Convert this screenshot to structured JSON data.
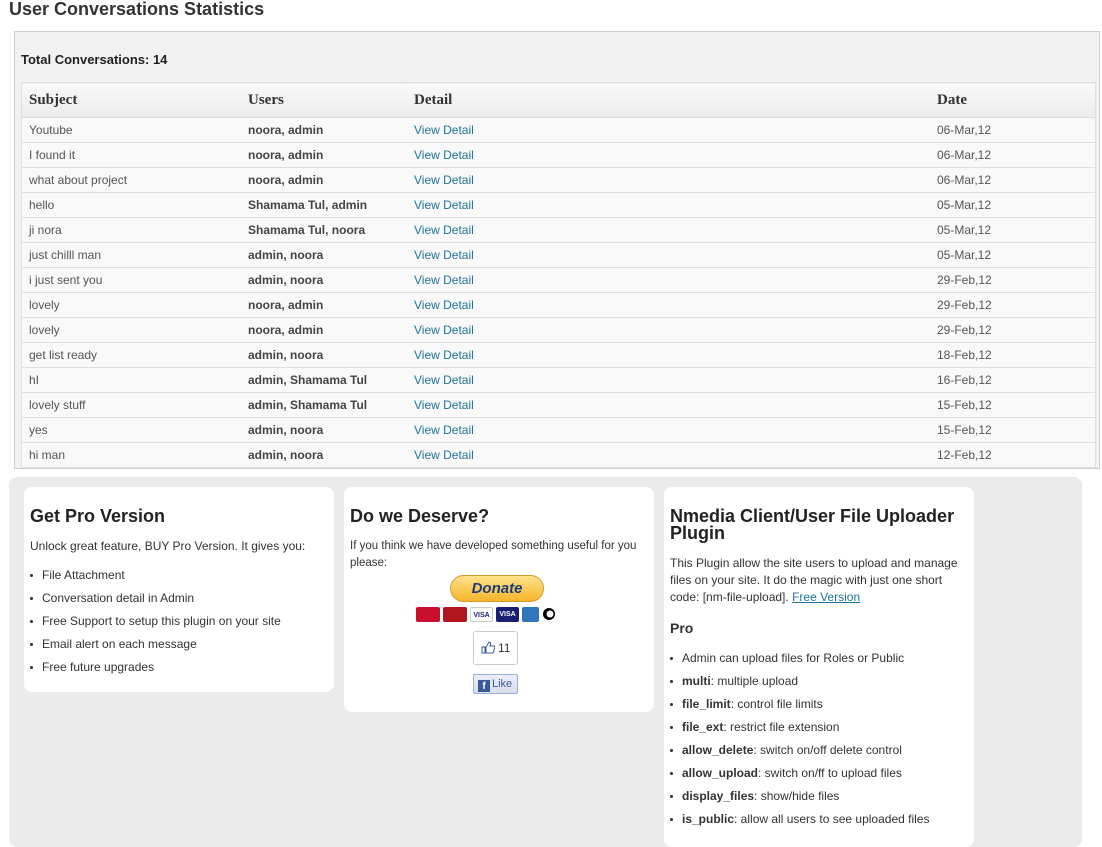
{
  "page_title": "User Conversations Statistics",
  "total_label": "Total Conversations: 14",
  "table": {
    "headers": [
      "Subject",
      "Users",
      "Detail",
      "Date"
    ],
    "rows": [
      {
        "subject": "Youtube",
        "users": "noora, admin",
        "detail": "View Detail",
        "date": "06-Mar,12"
      },
      {
        "subject": "I found it",
        "users": "noora, admin",
        "detail": "View Detail",
        "date": "06-Mar,12"
      },
      {
        "subject": "what about project",
        "users": "noora, admin",
        "detail": "View Detail",
        "date": "06-Mar,12"
      },
      {
        "subject": "hello",
        "users": "Shamama Tul, admin",
        "detail": "View Detail",
        "date": "05-Mar,12"
      },
      {
        "subject": "ji nora",
        "users": "Shamama Tul, noora",
        "detail": "View Detail",
        "date": "05-Mar,12"
      },
      {
        "subject": "just chilll man",
        "users": "admin, noora",
        "detail": "View Detail",
        "date": "05-Mar,12"
      },
      {
        "subject": "i just sent you",
        "users": "admin, noora",
        "detail": "View Detail",
        "date": "29-Feb,12"
      },
      {
        "subject": "lovely",
        "users": "noora, admin",
        "detail": "View Detail",
        "date": "29-Feb,12"
      },
      {
        "subject": "lovely",
        "users": "noora, admin",
        "detail": "View Detail",
        "date": "29-Feb,12"
      },
      {
        "subject": "get list ready",
        "users": "admin, noora",
        "detail": "View Detail",
        "date": "18-Feb,12"
      },
      {
        "subject": "hI",
        "users": "admin, Shamama Tul",
        "detail": "View Detail",
        "date": "16-Feb,12"
      },
      {
        "subject": "lovely stuff",
        "users": "admin, Shamama Tul",
        "detail": "View Detail",
        "date": "15-Feb,12"
      },
      {
        "subject": "yes",
        "users": "admin, noora",
        "detail": "View Detail",
        "date": "15-Feb,12"
      },
      {
        "subject": "hi man",
        "users": "admin, noora",
        "detail": "View Detail",
        "date": "12-Feb,12"
      }
    ]
  },
  "pro_card": {
    "title": "Get Pro Version",
    "intro": "Unlock great feature, BUY Pro Version. It gives you:",
    "features": [
      "File Attachment",
      "Conversation detail in Admin",
      "Free Support to setup this plugin on your site",
      "Email alert on each message",
      "Free future upgrades"
    ]
  },
  "deserve_card": {
    "title": "Do we Deserve?",
    "text": "If you think we have developed something useful for you please:",
    "donate_label": "Donate",
    "payment_cards": [
      "Maestro",
      "MasterCard",
      "VISA",
      "VISA",
      "AMEX",
      "DIRECT Debit"
    ],
    "like_count": "11",
    "like_label": "Like"
  },
  "nmedia_card": {
    "title": "Nmedia Client/User File Uploader Plugin",
    "text": "This Plugin allow the site users to upload and manage files on your site. It do the magic with just one short code: [nm-file-upload].",
    "free_link": "Free Version",
    "pro_heading": "Pro",
    "items": [
      {
        "key": "",
        "desc": "Admin can upload files for Roles or Public"
      },
      {
        "key": "multi",
        "desc": ": multiple upload"
      },
      {
        "key": "file_limit",
        "desc": ": control file limits"
      },
      {
        "key": "file_ext",
        "desc": ": restrict file extension"
      },
      {
        "key": "allow_delete",
        "desc": ": switch on/off delete control"
      },
      {
        "key": "allow_upload",
        "desc": ": switch on/ff to upload files"
      },
      {
        "key": "display_files",
        "desc": ": show/hide files"
      },
      {
        "key": "is_public",
        "desc": ": allow all users to see uploaded files"
      }
    ]
  },
  "colors": {
    "link": "#21759b",
    "panel_bg": "#ebebeb",
    "facebook": "#3b5998"
  }
}
